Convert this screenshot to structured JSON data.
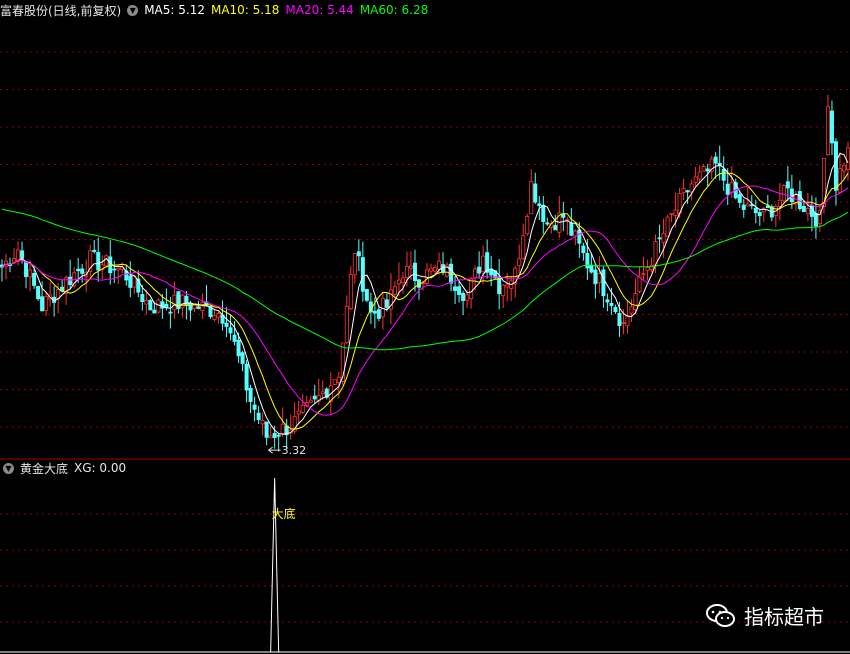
{
  "header": {
    "stock_title": "富春股份(日线,前复权)",
    "ma5": "MA5: 5.12",
    "ma10": "MA10: 5.18",
    "ma20": "MA20: 5.44",
    "ma60": "MA60: 6.28"
  },
  "sub_header": {
    "indicator_title": "黄金大底",
    "xg": "XG: 0.00"
  },
  "colors": {
    "background": "#000000",
    "up": "#ff3232",
    "down": "#54ffff",
    "ma5": "#ffffff",
    "ma10": "#ffff00",
    "ma20": "#ff00ff",
    "ma60": "#00ff00",
    "grid": "#8b0000",
    "signal_label": "#ffff00"
  },
  "watermark": {
    "text": "指标超市",
    "icon": "wechat-icon"
  },
  "chart_data": [
    {
      "type": "candlestick",
      "ylim": [
        3.1,
        9.2
      ],
      "low_annotation": {
        "label": "3.32",
        "value": 3.32,
        "index": 66
      },
      "anchors": [
        [
          0,
          5.75
        ],
        [
          4,
          6.0
        ],
        [
          10,
          5.2
        ],
        [
          16,
          5.55
        ],
        [
          22,
          5.85
        ],
        [
          30,
          5.7
        ],
        [
          37,
          5.2
        ],
        [
          45,
          5.25
        ],
        [
          53,
          5.15
        ],
        [
          56,
          5.05
        ],
        [
          62,
          3.9
        ],
        [
          66,
          3.4
        ],
        [
          72,
          3.55
        ],
        [
          78,
          3.85
        ],
        [
          84,
          4.3
        ],
        [
          88,
          6.0
        ],
        [
          92,
          5.1
        ],
        [
          96,
          5.2
        ],
        [
          100,
          5.7
        ],
        [
          104,
          5.6
        ],
        [
          110,
          5.75
        ],
        [
          116,
          5.35
        ],
        [
          120,
          5.9
        ],
        [
          124,
          5.5
        ],
        [
          128,
          5.65
        ],
        [
          132,
          6.9
        ],
        [
          136,
          6.35
        ],
        [
          140,
          6.45
        ],
        [
          146,
          5.8
        ],
        [
          152,
          5.3
        ],
        [
          155,
          4.95
        ],
        [
          160,
          5.65
        ],
        [
          168,
          6.55
        ],
        [
          172,
          6.9
        ],
        [
          178,
          7.15
        ],
        [
          184,
          6.6
        ],
        [
          190,
          6.45
        ],
        [
          196,
          6.8
        ],
        [
          200,
          6.6
        ],
        [
          204,
          6.4
        ],
        [
          206,
          8.1
        ],
        [
          208,
          6.9
        ],
        [
          211,
          7.4
        ]
      ],
      "ma_lines": [
        {
          "name": "MA5",
          "period": 5
        },
        {
          "name": "MA10",
          "period": 10
        },
        {
          "name": "MA20",
          "period": 20
        },
        {
          "name": "MA60",
          "period": 60,
          "start": 6.55
        }
      ]
    },
    {
      "type": "line",
      "series_name": "XG",
      "ylim": [
        0,
        1
      ],
      "signal": {
        "index": 68,
        "value": 1,
        "label": "大底"
      }
    }
  ]
}
